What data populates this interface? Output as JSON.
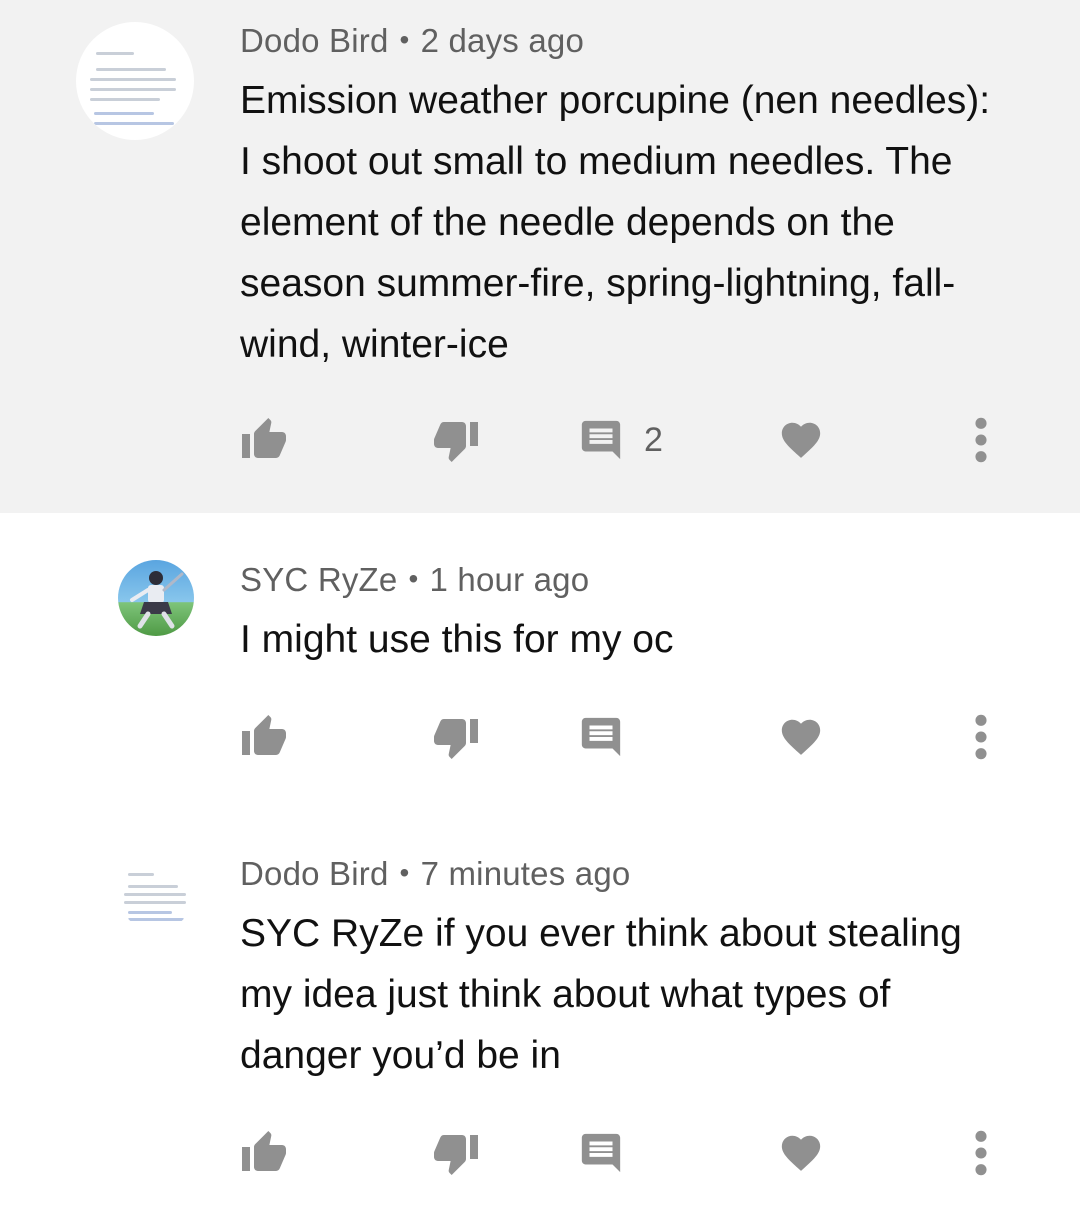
{
  "comments": [
    {
      "author": "Dodo Bird",
      "separator": "•",
      "time": "2 days ago",
      "text": "Emission weather porcupine (nen needles): I shoot out small to medium needles. The element of the needle depends on the season summer-fire, spring-lightning, fall-wind, winter-ice",
      "reply_count": "2",
      "highlighted": true
    },
    {
      "author": "SYC RyZe",
      "separator": "•",
      "time": "1 hour ago",
      "text": "I might use this for my oc",
      "reply_count": "",
      "highlighted": false
    },
    {
      "author": "Dodo Bird",
      "separator": "•",
      "time": "7 minutes ago",
      "text": "SYC RyZe if you ever think about stealing my idea just think about what types of danger you’d be in",
      "reply_count": "",
      "highlighted": false
    }
  ],
  "icons": {
    "like": "thumb-up-icon",
    "dislike": "thumb-down-icon",
    "reply": "comment-icon",
    "heart": "heart-icon",
    "more": "more-vert-icon"
  },
  "colors": {
    "highlight_bg": "#f2f2f2",
    "icon": "#909090",
    "meta_text": "#606060",
    "body_text": "#111111"
  }
}
